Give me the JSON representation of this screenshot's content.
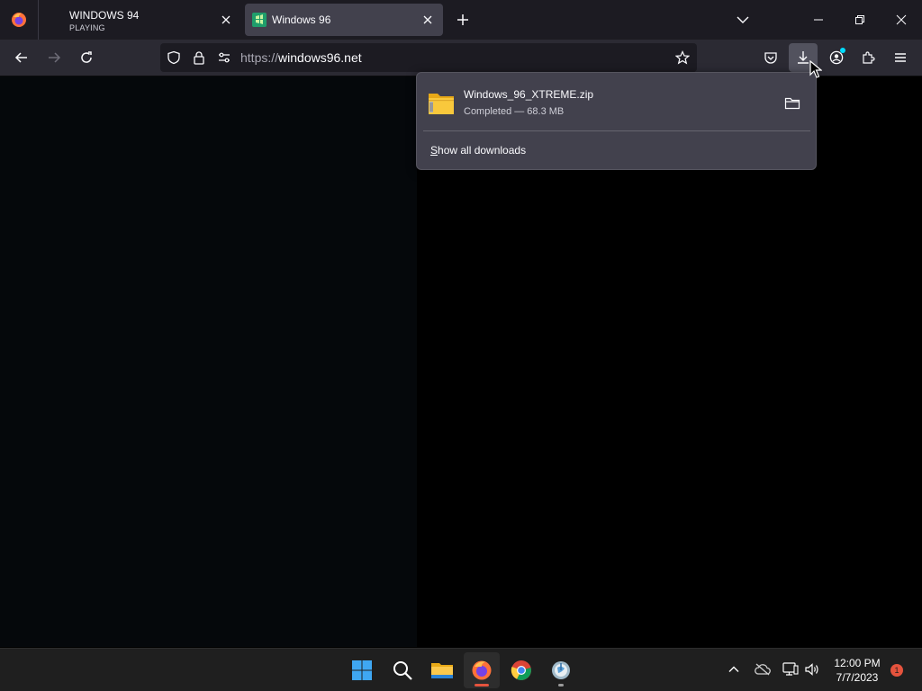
{
  "tabs": [
    {
      "title": "WINDOWS 94",
      "subtitle": "PLAYING",
      "active": false
    },
    {
      "title": "Windows 96",
      "active": true
    }
  ],
  "navbar": {
    "url_scheme": "https://",
    "url_host": "windows96.net"
  },
  "downloads": {
    "file_name": "Windows_96_XTREME.zip",
    "status": "Completed — 68.3 MB",
    "show_all": "Show all downloads"
  },
  "taskbar": {
    "time": "12:00 PM",
    "date": "7/7/2023",
    "notification_count": "1"
  },
  "colors": {
    "accent_download_badge": "#00ddff",
    "firefox_indicator": "#e5533d",
    "notification_badge": "#e5533d"
  }
}
